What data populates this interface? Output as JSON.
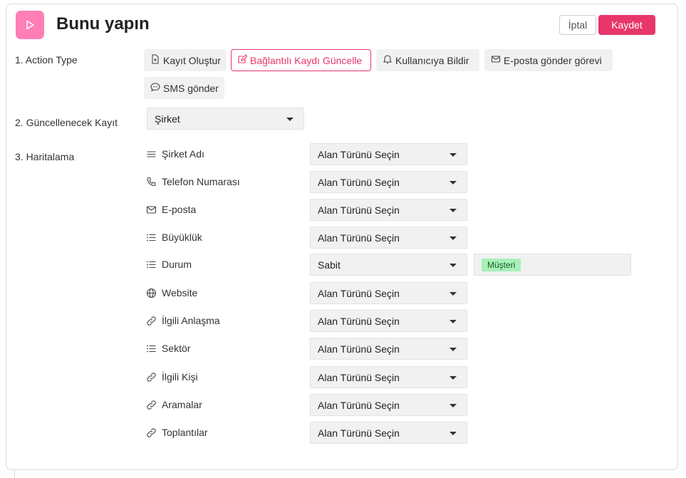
{
  "header": {
    "title": "Bunu yapın",
    "cancel_label": "İptal",
    "save_label": "Kaydet",
    "accent": "#e8366a",
    "icon_bg": "#ff7eb6"
  },
  "action_type": {
    "label": "1. Action Type",
    "options": [
      {
        "label": "Kayıt Oluştur",
        "icon": "file-plus-icon",
        "selected": false
      },
      {
        "label": "Bağlantılı Kaydı Güncelle",
        "icon": "edit-icon",
        "selected": true
      },
      {
        "label": "Kullanıcıya Bildir",
        "icon": "bell-icon",
        "selected": false
      },
      {
        "label": "E-posta gönder görevi",
        "icon": "mail-icon",
        "selected": false
      },
      {
        "label": "SMS gönder",
        "icon": "sms-icon",
        "selected": false
      }
    ]
  },
  "record": {
    "label": "2. Güncellenecek Kayıt",
    "value": "Şirket"
  },
  "mapping": {
    "label": "3. Haritalama",
    "rows": [
      {
        "field": "Şirket Adı",
        "icon": "text-lines-icon",
        "value": "Alan Türünü Seçin"
      },
      {
        "field": "Telefon Numarası",
        "icon": "phone-icon",
        "value": "Alan Türünü Seçin"
      },
      {
        "field": "E-posta",
        "icon": "mail-icon",
        "value": "Alan Türünü Seçin"
      },
      {
        "field": "Büyüklük",
        "icon": "list-icon",
        "value": "Alan Türünü Seçin"
      },
      {
        "field": "Durum",
        "icon": "list-icon",
        "value": "Sabit",
        "tag": "Müşteri"
      },
      {
        "field": "Website",
        "icon": "globe-icon",
        "value": "Alan Türünü Seçin"
      },
      {
        "field": "İlgili Anlaşma",
        "icon": "link-icon",
        "value": "Alan Türünü Seçin"
      },
      {
        "field": "Sektör",
        "icon": "list-icon",
        "value": "Alan Türünü Seçin"
      },
      {
        "field": "İlgili Kişi",
        "icon": "link-icon",
        "value": "Alan Türünü Seçin"
      },
      {
        "field": "Aramalar",
        "icon": "link-icon",
        "value": "Alan Türünü Seçin"
      },
      {
        "field": "Toplantılar",
        "icon": "link-icon",
        "value": "Alan Türünü Seçin"
      }
    ]
  }
}
